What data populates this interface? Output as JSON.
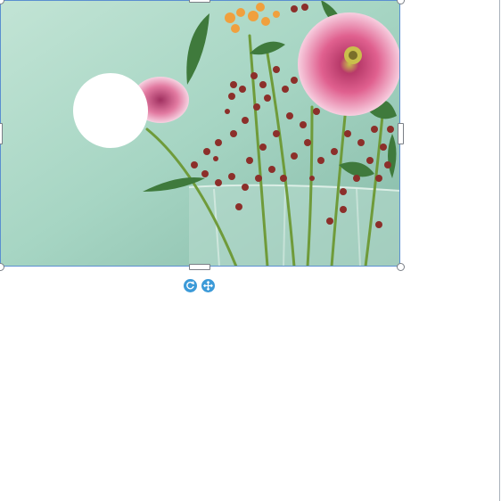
{
  "document": {
    "page_background": "#ffffff",
    "page_edge_color": "#a9b1bb"
  },
  "image": {
    "selected": true,
    "selection_color": "#5b8fd0"
  },
  "image_toolbar": {
    "rotate_icon": "rotate-icon",
    "move_icon": "move-icon",
    "button_color": "#3c9ad8"
  }
}
